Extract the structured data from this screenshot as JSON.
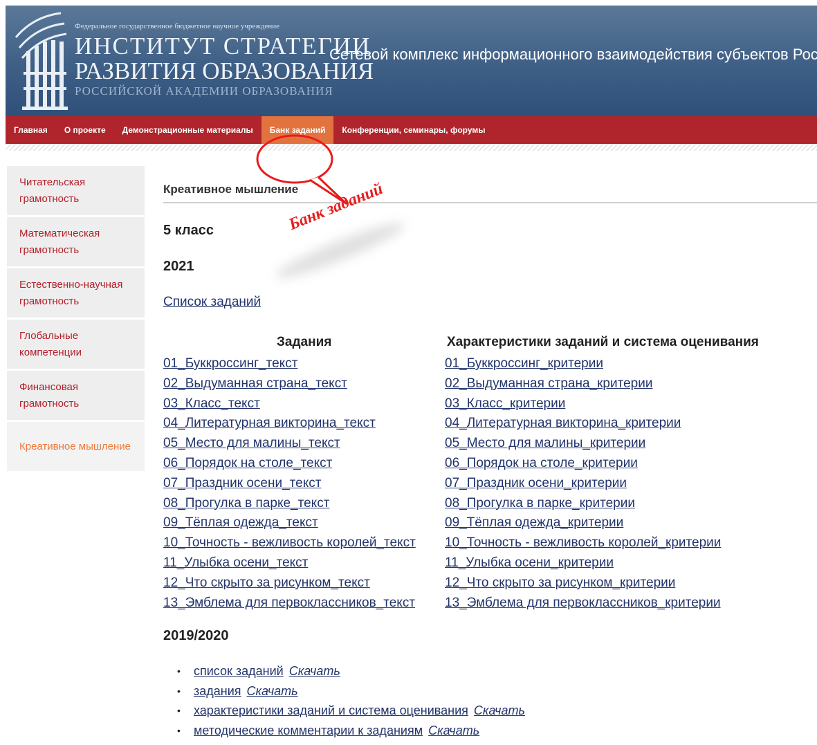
{
  "header": {
    "org_sub": "Федеральное государственное бюджетное научное учреждение",
    "org_line1": "ИНСТИТУТ СТРАТЕГИИ",
    "org_line2": "РАЗВИТИЯ ОБРАЗОВАНИЯ",
    "org_line3": "РОССИЙСКОЙ АКАДЕМИИ ОБРАЗОВАНИЯ",
    "site_title": "Сетевой комплекс информационного взаимодействия субъектов Российско"
  },
  "nav": {
    "items": [
      {
        "label": "Главная"
      },
      {
        "label": "О проекте"
      },
      {
        "label": "Демонстрационные материалы"
      },
      {
        "label": "Банк заданий"
      },
      {
        "label": "Конференции, семинары, форумы"
      }
    ],
    "active_color": "#e2733f",
    "bar_color": "#b0252b"
  },
  "sidebar": {
    "items": [
      {
        "label": "Читательская грамотность"
      },
      {
        "label": "Математическая грамотность"
      },
      {
        "label": "Естественно-научная грамотность"
      },
      {
        "label": "Глобальные компетенции"
      },
      {
        "label": "Финансовая грамотность"
      },
      {
        "label": "Креативное мышление"
      }
    ]
  },
  "main": {
    "title": "Креативное мышление",
    "grade": "5 класс",
    "year1": "2021",
    "list_link": "Список заданий",
    "col_tasks_header": "Задания",
    "col_criteria_header": "Характеристики заданий и система оценивания",
    "tasks": [
      "01_Буккроссинг_текст",
      "02_Выдуманная страна_текст",
      "03_Класс_текст",
      "04_Литературная викторина_текст",
      "05_Место для малины_текст",
      "06_Порядок на столе_текст",
      "07_Праздник осени_текст",
      "08_Прогулка в парке_текст",
      "09_Тёплая одежда_текст",
      "10_Точность - вежливость королей_текст",
      "11_Улыбка осени_текст",
      "12_Что скрыто за рисунком_текст",
      "13_Эмблема для первоклассников_текст"
    ],
    "criteria": [
      "01_Буккроссинг_критерии",
      "02_Выдуманная страна_критерии",
      "03_Класс_критерии",
      "04_Литературная викторина_критерии",
      "05_Место для малины_критерии",
      "06_Порядок на столе_критерии",
      "07_Праздник осени_критерии",
      "08_Прогулка в парке_критерии",
      "09_Тёплая одежда_критерии",
      "10_Точность - вежливость королей_критерии",
      "11_Улыбка осени_критерии",
      "12_Что скрыто за рисунком_критерии",
      "13_Эмблема для первоклассников_критерии"
    ],
    "year2": "2019/2020",
    "downloads": [
      {
        "label": "список заданий",
        "action": "Скачать"
      },
      {
        "label": "задания",
        "action": "Скачать"
      },
      {
        "label": "характеристики заданий и система оценивания",
        "action": "Скачать"
      },
      {
        "label": "методические комментарии к заданиям",
        "action": "Скачать"
      }
    ],
    "bullet": "•"
  },
  "annotation": {
    "text": "Банк заданий",
    "color": "#e81c1c"
  }
}
